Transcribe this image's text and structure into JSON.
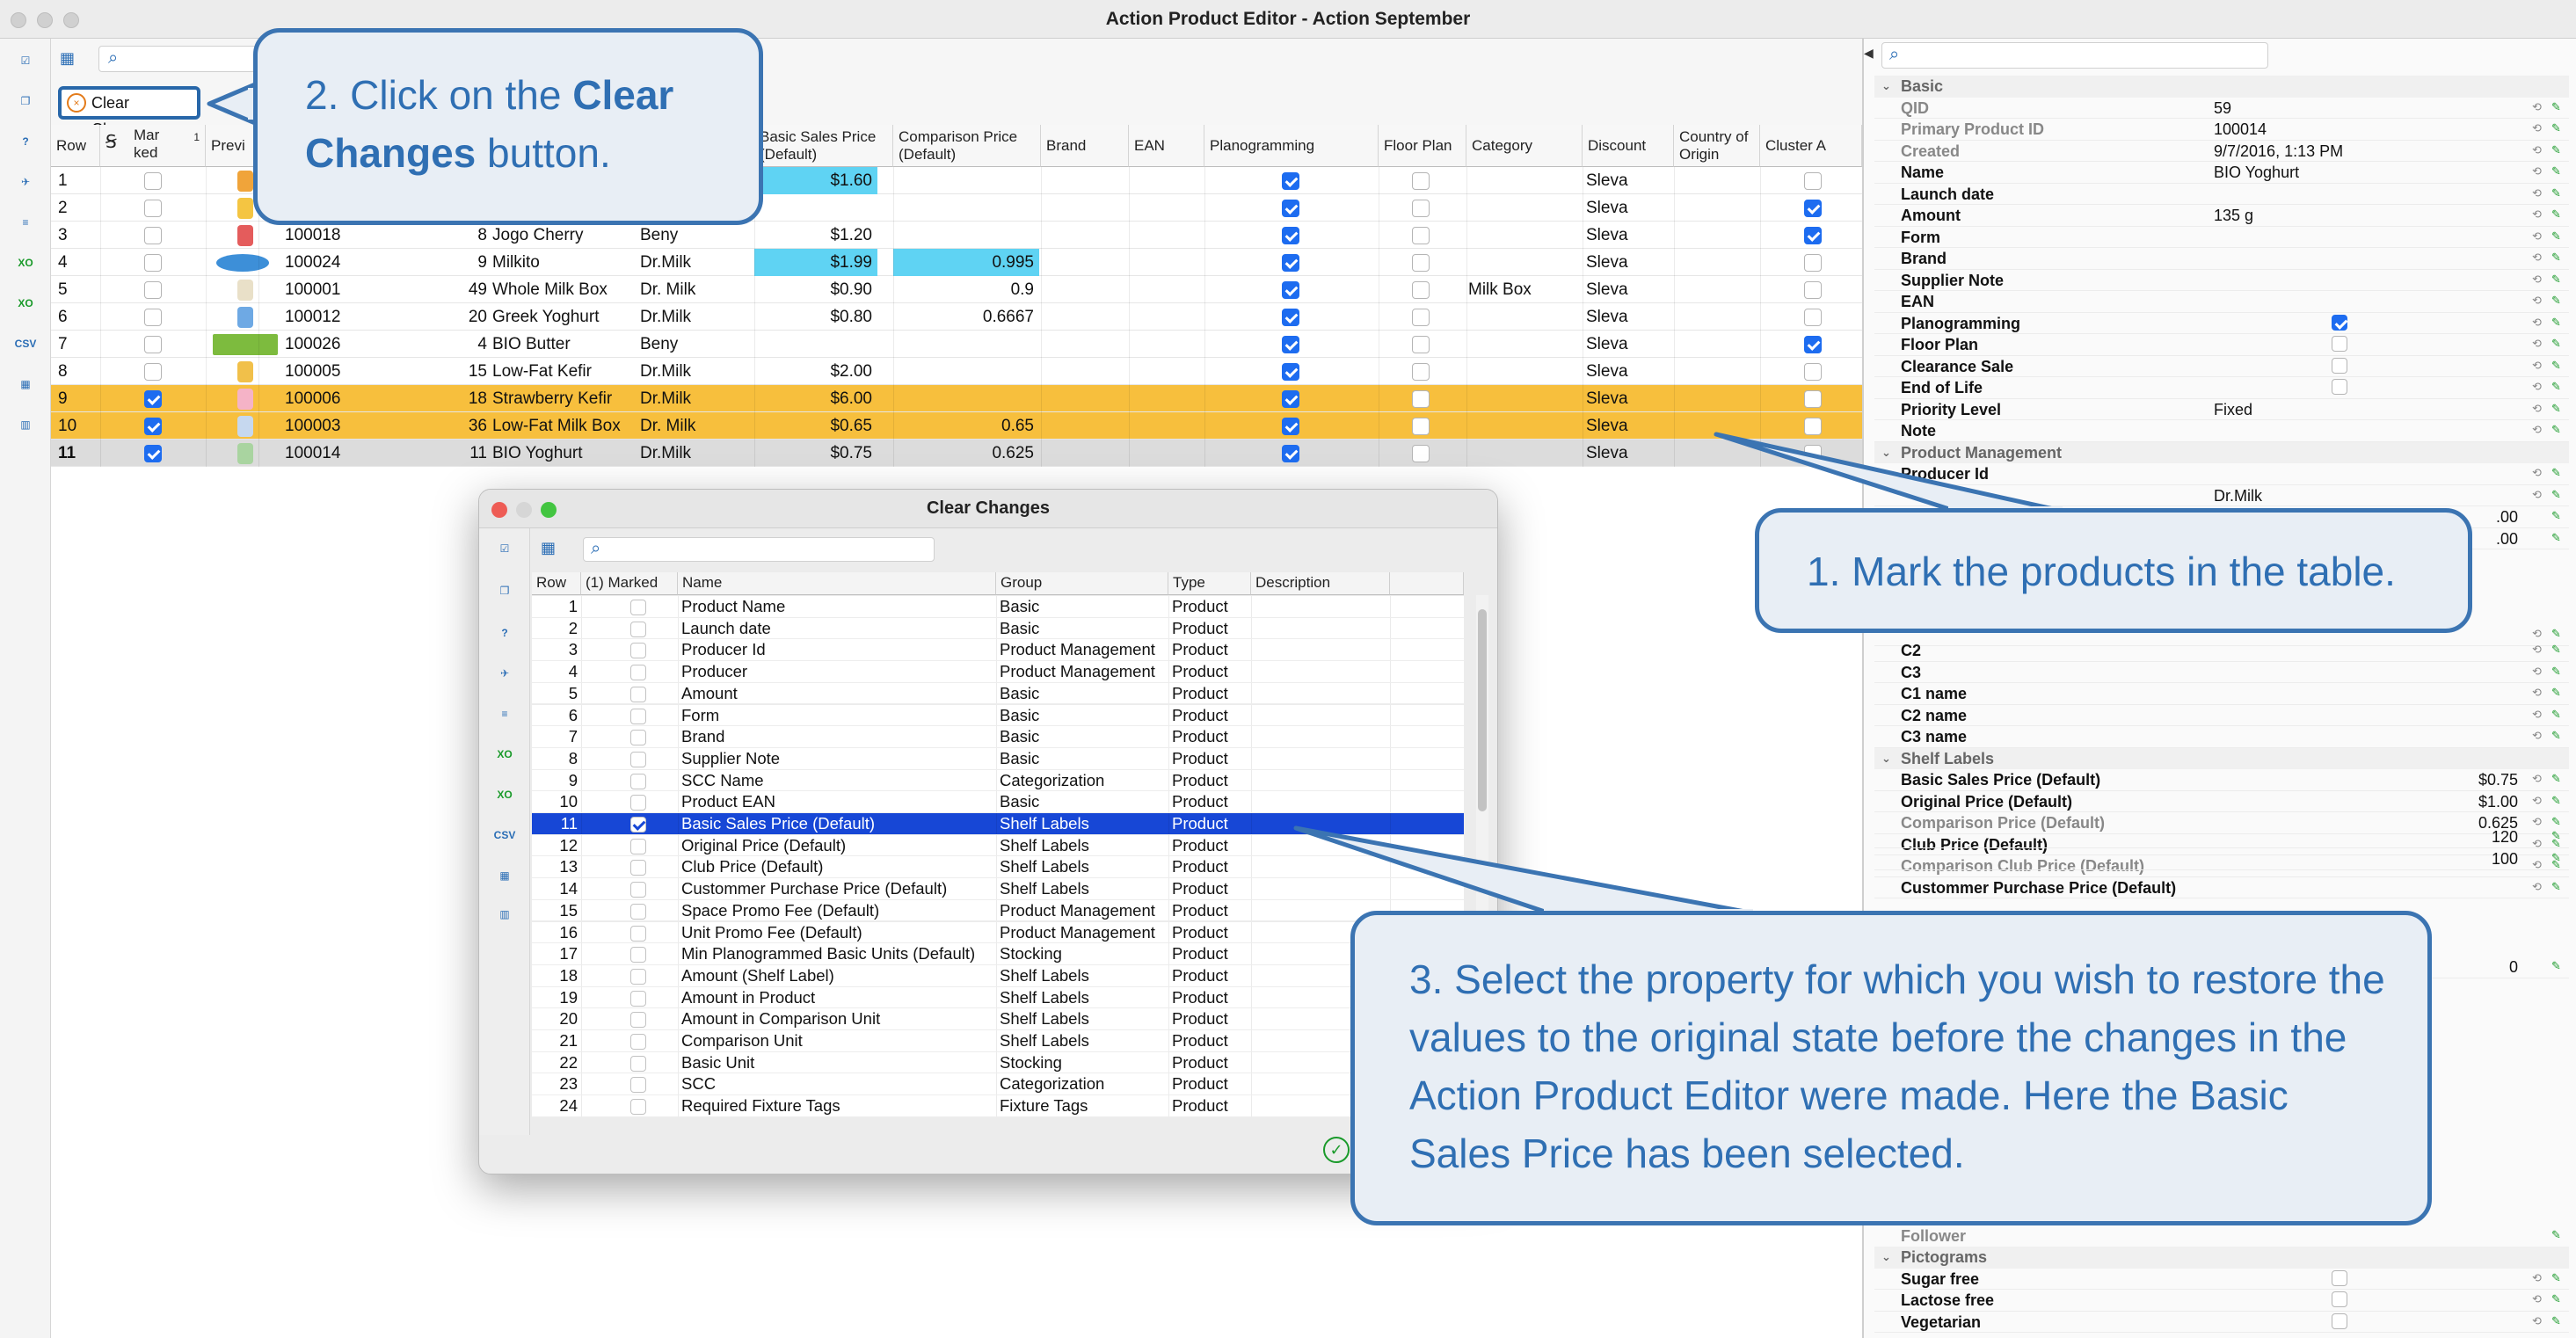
{
  "window": {
    "title": "Action Product Editor - Action September"
  },
  "toolbar": {
    "clear_changes_label": "Clear Changes"
  },
  "table": {
    "columns": [
      "Row",
      "Mar\nked",
      "Previ",
      "",
      "",
      "",
      "",
      "Basic Sales Price (Default)",
      "Comparison Price (Default)",
      "Brand",
      "EAN",
      "Planogramming",
      "Floor Plan",
      "Category",
      "Discount",
      "Country of Origin",
      "Cluster A"
    ],
    "header": {
      "row": "Row",
      "marked": "Mar ked",
      "marked_sort": "1",
      "preview": "Previ",
      "basic_sales_price": "Basic Sales Price (Default)",
      "comparison_price": "Comparison Price (Default)",
      "brand": "Brand",
      "ean": "EAN",
      "planogramming": "Planogramming",
      "floor_plan": "Floor Plan",
      "category": "Category",
      "discount": "Discount",
      "country": "Country of Origin",
      "cluster": "Cluster A"
    },
    "rows": [
      {
        "row": "1",
        "marked": false,
        "pid": "",
        "qty": "",
        "name": "",
        "producer": "",
        "bsp": "$1.60",
        "cp": "",
        "category": "",
        "discount": "Sleva",
        "plano": true,
        "cluster": false,
        "hl": "none",
        "bsp_hl": true,
        "cp_hl": false
      },
      {
        "row": "2",
        "marked": false,
        "pid": "",
        "qty": "",
        "name": "",
        "producer": "",
        "bsp": "",
        "cp": "",
        "category": "",
        "discount": "Sleva",
        "plano": true,
        "cluster": true,
        "hl": "none",
        "bsp_hl": false,
        "cp_hl": false
      },
      {
        "row": "3",
        "marked": false,
        "pid": "100018",
        "qty": "8",
        "name": "Jogo Cherry",
        "producer": "Beny",
        "bsp": "$1.20",
        "cp": "",
        "category": "",
        "discount": "Sleva",
        "plano": true,
        "cluster": true,
        "hl": "none",
        "bsp_hl": false,
        "cp_hl": false
      },
      {
        "row": "4",
        "marked": false,
        "pid": "100024",
        "qty": "9",
        "name": "Milkito",
        "producer": "Dr.Milk",
        "bsp": "$1.99",
        "cp": "0.995",
        "category": "",
        "discount": "Sleva",
        "plano": true,
        "cluster": false,
        "hl": "none",
        "bsp_hl": true,
        "cp_hl": true
      },
      {
        "row": "5",
        "marked": false,
        "pid": "100001",
        "qty": "49",
        "name": "Whole Milk Box",
        "producer": "Dr. Milk",
        "bsp": "$0.90",
        "cp": "0.9",
        "category": "Milk Box",
        "discount": "Sleva",
        "plano": true,
        "cluster": false,
        "hl": "none",
        "bsp_hl": false,
        "cp_hl": false
      },
      {
        "row": "6",
        "marked": false,
        "pid": "100012",
        "qty": "20",
        "name": "Greek Yoghurt",
        "producer": "Dr.Milk",
        "bsp": "$0.80",
        "cp": "0.6667",
        "category": "",
        "discount": "Sleva",
        "plano": true,
        "cluster": false,
        "hl": "none",
        "bsp_hl": false,
        "cp_hl": false
      },
      {
        "row": "7",
        "marked": false,
        "pid": "100026",
        "qty": "4",
        "name": "BIO Butter",
        "producer": "Beny",
        "bsp": "",
        "cp": "",
        "category": "",
        "discount": "Sleva",
        "plano": true,
        "cluster": true,
        "hl": "none",
        "bsp_hl": false,
        "cp_hl": false
      },
      {
        "row": "8",
        "marked": false,
        "pid": "100005",
        "qty": "15",
        "name": "Low-Fat Kefir",
        "producer": "Dr.Milk",
        "bsp": "$2.00",
        "cp": "",
        "category": "",
        "discount": "Sleva",
        "plano": true,
        "cluster": false,
        "hl": "none",
        "bsp_hl": false,
        "cp_hl": false
      },
      {
        "row": "9",
        "marked": true,
        "pid": "100006",
        "qty": "18",
        "name": "Strawberry Kefir",
        "producer": "Dr.Milk",
        "bsp": "$6.00",
        "cp": "",
        "category": "",
        "discount": "Sleva",
        "plano": true,
        "cluster": false,
        "hl": "orange",
        "bsp_hl": false,
        "cp_hl": false
      },
      {
        "row": "10",
        "marked": true,
        "pid": "100003",
        "qty": "36",
        "name": "Low-Fat Milk Box",
        "producer": "Dr. Milk",
        "bsp": "$0.65",
        "cp": "0.65",
        "category": "",
        "discount": "Sleva",
        "plano": true,
        "cluster": false,
        "hl": "orange",
        "bsp_hl": false,
        "cp_hl": false
      },
      {
        "row": "11",
        "marked": true,
        "pid": "100014",
        "qty": "11",
        "name": "BIO Yoghurt",
        "producer": "Dr.Milk",
        "bsp": "$0.75",
        "cp": "0.625",
        "category": "",
        "discount": "Sleva",
        "plano": true,
        "cluster": false,
        "hl": "grey",
        "bsp_hl": false,
        "cp_hl": false
      }
    ]
  },
  "properties": {
    "groups": {
      "basic": "Basic",
      "product_management": "Product Management",
      "shelf_labels": "Shelf Labels",
      "pictograms": "Pictograms"
    },
    "basic": [
      {
        "name": "QID",
        "value": "59",
        "style": "g"
      },
      {
        "name": "Primary Product ID",
        "value": "100014",
        "style": "g"
      },
      {
        "name": "Created",
        "value": "9/7/2016, 1:13 PM",
        "style": "g"
      },
      {
        "name": "Name",
        "value": "BIO Yoghurt",
        "style": "b"
      },
      {
        "name": "Launch date",
        "value": "",
        "style": "b"
      },
      {
        "name": "Amount",
        "value": "135 g",
        "style": "b"
      },
      {
        "name": "Form",
        "value": "",
        "style": "b"
      },
      {
        "name": "Brand",
        "value": "",
        "style": "b"
      },
      {
        "name": "Supplier Note",
        "value": "",
        "style": "b"
      },
      {
        "name": "EAN",
        "value": "",
        "style": "b"
      },
      {
        "name": "Planogramming",
        "value": "",
        "style": "b",
        "check": true
      },
      {
        "name": "Floor Plan",
        "value": "",
        "style": "b",
        "check": false
      },
      {
        "name": "Clearance Sale",
        "value": "",
        "style": "b",
        "check": false
      },
      {
        "name": "End of Life",
        "value": "",
        "style": "b",
        "check": false
      },
      {
        "name": "Priority Level",
        "value": "Fixed",
        "style": "b"
      },
      {
        "name": "Note",
        "value": "",
        "style": "b"
      }
    ],
    "pm_partial": [
      {
        "name": "Producer Id",
        "value": "",
        "style": "b"
      },
      {
        "name": "",
        "value": "Dr.Milk",
        "style": "b"
      }
    ],
    "pm_right_values": [
      ".00",
      ".00"
    ],
    "c_rows": [
      {
        "name": "C2",
        "style": "b"
      },
      {
        "name": "C3",
        "style": "b"
      },
      {
        "name": "C1 name",
        "style": "b"
      },
      {
        "name": "C2 name",
        "style": "b"
      },
      {
        "name": "C3 name",
        "style": "b"
      }
    ],
    "shelf_labels": [
      {
        "name": "Basic Sales Price (Default)",
        "value": "$0.75",
        "style": "b"
      },
      {
        "name": "Original Price (Default)",
        "value": "$1.00",
        "style": "b"
      },
      {
        "name": "Comparison Price (Default)",
        "value": "0.625",
        "style": "g"
      },
      {
        "name": "Club Price (Default)",
        "value": "",
        "style": "b"
      },
      {
        "name": "Comparison Club Price (Default)",
        "value": "",
        "style": "g"
      },
      {
        "name": "Custommer Purchase Price (Default)",
        "value": "",
        "style": "b"
      }
    ],
    "lower_values": [
      "120",
      "100",
      "0"
    ],
    "follower": "Follower",
    "pictograms": [
      {
        "name": "Sugar free",
        "style": "b"
      },
      {
        "name": "Lactose free",
        "style": "b"
      },
      {
        "name": "Vegetarian",
        "style": "b"
      }
    ]
  },
  "dialog": {
    "title": "Clear Changes",
    "header": {
      "row": "Row",
      "marked": "(1) Marked",
      "name": "Name",
      "group": "Group",
      "type": "Type",
      "description": "Description"
    },
    "rows": [
      {
        "row": "1",
        "marked": false,
        "name": "Product Name",
        "group": "Basic",
        "type": "Product"
      },
      {
        "row": "2",
        "marked": false,
        "name": "Launch date",
        "group": "Basic",
        "type": "Product"
      },
      {
        "row": "3",
        "marked": false,
        "name": "Producer Id",
        "group": "Product Management",
        "type": "Product"
      },
      {
        "row": "4",
        "marked": false,
        "name": "Producer",
        "group": "Product Management",
        "type": "Product"
      },
      {
        "row": "5",
        "marked": false,
        "name": "Amount",
        "group": "Basic",
        "type": "Product"
      },
      {
        "row": "6",
        "marked": false,
        "name": "Form",
        "group": "Basic",
        "type": "Product"
      },
      {
        "row": "7",
        "marked": false,
        "name": "Brand",
        "group": "Basic",
        "type": "Product"
      },
      {
        "row": "8",
        "marked": false,
        "name": "Supplier Note",
        "group": "Basic",
        "type": "Product"
      },
      {
        "row": "9",
        "marked": false,
        "name": "SCC Name",
        "group": "Categorization",
        "type": "Product"
      },
      {
        "row": "10",
        "marked": false,
        "name": "Product EAN",
        "group": "Basic",
        "type": "Product"
      },
      {
        "row": "11",
        "marked": true,
        "name": "Basic Sales Price (Default)",
        "group": "Shelf Labels",
        "type": "Product",
        "selected": true
      },
      {
        "row": "12",
        "marked": false,
        "name": "Original Price (Default)",
        "group": "Shelf Labels",
        "type": "Product"
      },
      {
        "row": "13",
        "marked": false,
        "name": "Club Price (Default)",
        "group": "Shelf Labels",
        "type": "Product"
      },
      {
        "row": "14",
        "marked": false,
        "name": "Custommer Purchase Price (Default)",
        "group": "Shelf Labels",
        "type": "Product"
      },
      {
        "row": "15",
        "marked": false,
        "name": "Space Promo Fee (Default)",
        "group": "Product Management",
        "type": "Product"
      },
      {
        "row": "16",
        "marked": false,
        "name": "Unit Promo Fee (Default)",
        "group": "Product Management",
        "type": "Product"
      },
      {
        "row": "17",
        "marked": false,
        "name": "Min Planogrammed Basic Units (Default)",
        "group": "Stocking",
        "type": "Product"
      },
      {
        "row": "18",
        "marked": false,
        "name": "Amount (Shelf Label)",
        "group": "Shelf Labels",
        "type": "Product"
      },
      {
        "row": "19",
        "marked": false,
        "name": "Amount in Product",
        "group": "Shelf Labels",
        "type": "Product"
      },
      {
        "row": "20",
        "marked": false,
        "name": "Amount in Comparison Unit",
        "group": "Shelf Labels",
        "type": "Product"
      },
      {
        "row": "21",
        "marked": false,
        "name": "Comparison Unit",
        "group": "Shelf Labels",
        "type": "Product"
      },
      {
        "row": "22",
        "marked": false,
        "name": "Basic Unit",
        "group": "Stocking",
        "type": "Product"
      },
      {
        "row": "23",
        "marked": false,
        "name": "SCC",
        "group": "Categorization",
        "type": "Product"
      },
      {
        "row": "24",
        "marked": false,
        "name": "Required Fixture Tags",
        "group": "Fixture Tags",
        "type": "Product"
      }
    ]
  },
  "callouts": {
    "step1": "1. Mark the products in the table.",
    "step2_prefix": "2. Click on the ",
    "step2_bold": "Clear Changes",
    "step2_suffix": " button.",
    "step3": "3. Select the property for which you wish to restore the values to the original state before the changes in the Action Product Editor were made. Here the Basic Sales Price has been selected."
  },
  "colors": {
    "orange_row": "#f7bf3d",
    "cyan_cell": "#5fd3f3",
    "selection": "#1747d6",
    "callout_border": "#3b74b2",
    "callout_fill": "#e8eef5",
    "callout_text": "#2f6fb3"
  }
}
